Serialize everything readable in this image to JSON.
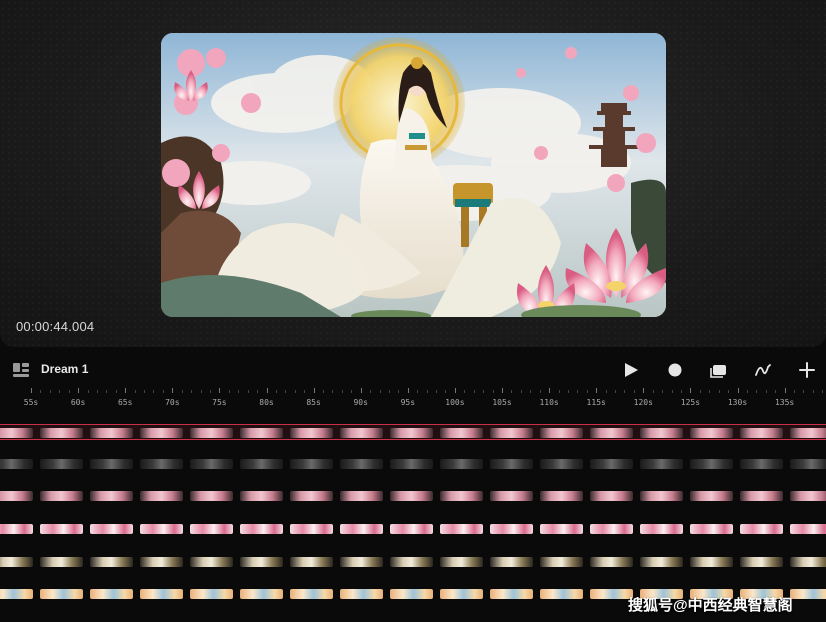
{
  "preview": {
    "timecode": "00:00:44.004",
    "artwork_name": "lotus-goddess-artwork"
  },
  "toolbar": {
    "project_name": "Dream 1",
    "icons": [
      "layers-icon",
      "play-icon",
      "record-icon",
      "stack-icon",
      "draw-icon",
      "add-icon"
    ]
  },
  "timeline": {
    "ticks": [
      "55s",
      "60s",
      "65s",
      "70s",
      "75s",
      "80s",
      "85s",
      "90s",
      "95s",
      "100s",
      "105s",
      "110s",
      "115s",
      "120s",
      "125s",
      "130s",
      "135s"
    ],
    "tracks": [
      {
        "name": "track-1",
        "style": "pink",
        "highlighted": true
      },
      {
        "name": "track-2",
        "style": "dark"
      },
      {
        "name": "track-3",
        "style": "pink"
      },
      {
        "name": "track-4",
        "style": "lotus"
      },
      {
        "name": "track-5",
        "style": "gold"
      },
      {
        "name": "track-6",
        "style": "bright"
      }
    ]
  },
  "watermark": "搜狐号@中西经典智慧阁",
  "colors": {
    "accent_highlight": "#c9304a",
    "background": "#0a0a0a",
    "panel": "#1c1c1c"
  }
}
